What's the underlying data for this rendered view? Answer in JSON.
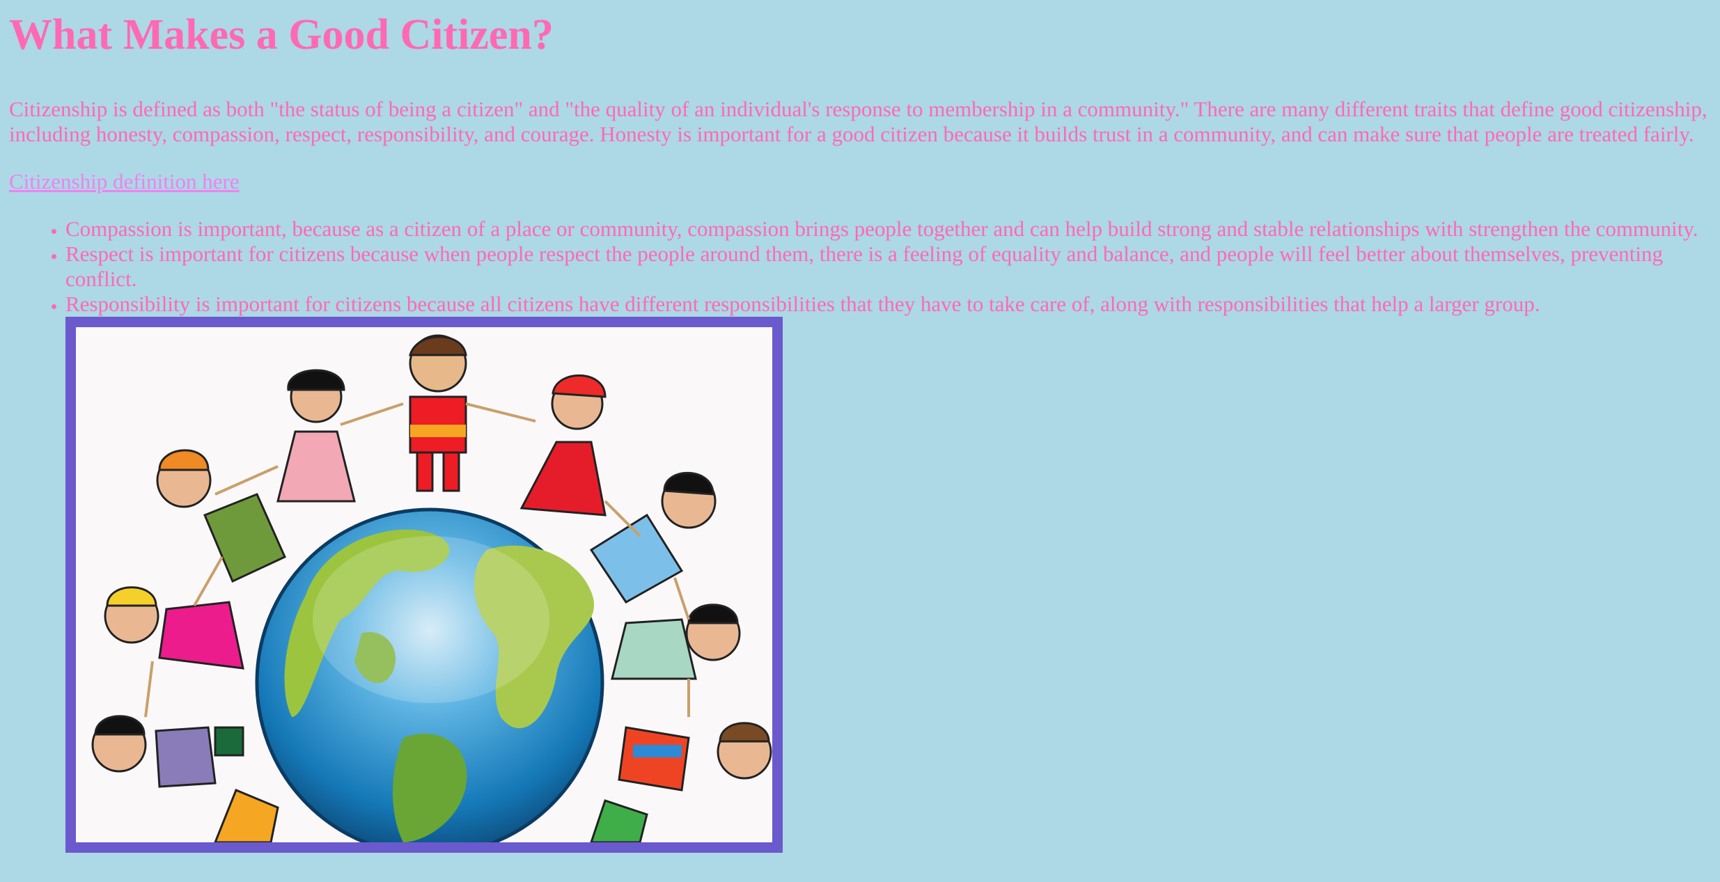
{
  "page": {
    "title": "What Makes a Good Citizen?",
    "intro": "Citizenship is defined as both \"the status of being a citizen\" and \"the quality of an individual's response to membership in a community.\" There are many different traits that define good citizenship, including honesty, compassion, respect, responsibility, and courage. Honesty is important for a good citizen because it builds trust in a community, and can make sure that people are treated fairly.",
    "link_text": "Citizenship definition here",
    "traits": [
      "Compassion is important, because as a citizen of a place or community, compassion brings people together and can help build strong and stable relationships with strengthen the community.",
      "Respect is important for citizens because when people respect the people around them, there is a feeling of equality and balance, and people will feel better about themselves, preventing conflict.",
      "Responsibility is important for citizens because all citizens have different responsibilities that they have to take care of, along with responsibilities that help a larger group."
    ],
    "image": {
      "subject": "cartoon children holding hands around the globe",
      "frame_color": "#6a5acd"
    }
  },
  "colors": {
    "background": "#add8e6",
    "text": "#ff69b4",
    "link": "#ee82ee"
  }
}
